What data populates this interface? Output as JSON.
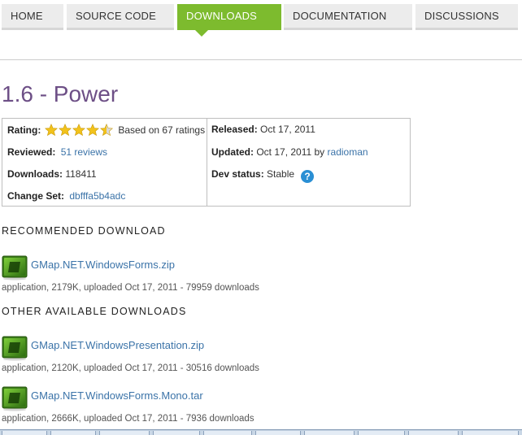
{
  "nav": {
    "tabs": [
      {
        "label": "HOME",
        "active": false
      },
      {
        "label": "SOURCE CODE",
        "active": false
      },
      {
        "label": "DOWNLOADS",
        "active": true
      },
      {
        "label": "DOCUMENTATION",
        "active": false
      },
      {
        "label": "DISCUSSIONS",
        "active": false
      }
    ]
  },
  "release": {
    "title": "1.6 - Power",
    "rating": {
      "label": "Rating:",
      "stars": 4.5,
      "max_stars": 5,
      "based_on": "Based on 67 ratings"
    },
    "reviewed": {
      "label": "Reviewed:",
      "link": "51 reviews"
    },
    "downloads": {
      "label": "Downloads:",
      "value": "118411"
    },
    "change_set": {
      "label": "Change Set:",
      "link": "dbfffa5b4adc"
    },
    "released": {
      "label": "Released:",
      "value": "Oct 17, 2011"
    },
    "updated": {
      "label": "Updated:",
      "value": "Oct 17, 2011 by",
      "user": "radioman"
    },
    "dev_status": {
      "label": "Dev status:",
      "value": "Stable"
    }
  },
  "recommended": {
    "heading": "RECOMMENDED DOWNLOAD",
    "file": {
      "name": "GMap.NET.WindowsForms.zip",
      "meta": "application, 2179K, uploaded Oct 17, 2011 - 79959 downloads"
    }
  },
  "other": {
    "heading": "OTHER AVAILABLE DOWNLOADS",
    "files": [
      {
        "name": "GMap.NET.WindowsPresentation.zip",
        "meta": "application, 2120K, uploaded Oct 17, 2011 - 30516 downloads"
      },
      {
        "name": "GMap.NET.WindowsForms.Mono.tar",
        "meta": "application, 2666K, uploaded Oct 17, 2011 - 7936 downloads"
      }
    ]
  },
  "colors": {
    "accent": "#7dbb2e",
    "title": "#6d4f86",
    "link": "#3b73a8",
    "star": "#f2c21b"
  }
}
